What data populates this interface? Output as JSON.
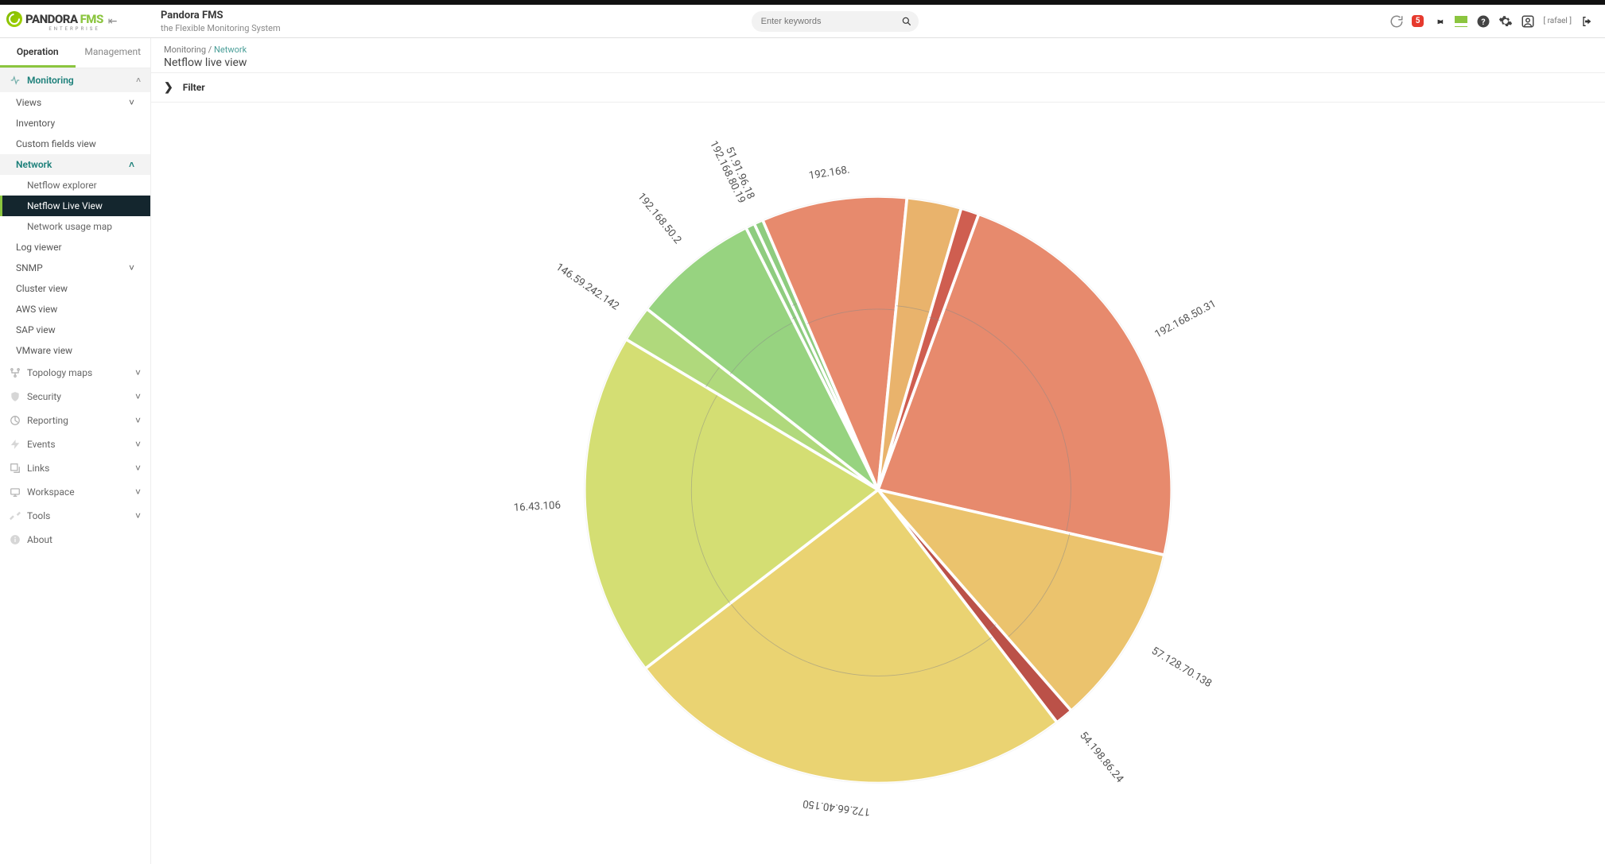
{
  "header": {
    "product": "PANDORA",
    "product_suffix": "FMS",
    "edition": "ENTERPRISE",
    "title": "Pandora FMS",
    "subtitle": "the Flexible Monitoring System",
    "search_placeholder": "Enter keywords",
    "alert_count": "5",
    "user_label": "[ rafael ]"
  },
  "tabs": {
    "operation": "Operation",
    "management": "Management"
  },
  "sidebar": {
    "monitoring": "Monitoring",
    "views": "Views",
    "inventory": "Inventory",
    "custom_fields": "Custom fields view",
    "network": "Network",
    "netflow_explorer": "Netflow explorer",
    "netflow_live": "Netflow Live View",
    "usage_map": "Network usage map",
    "log_viewer": "Log viewer",
    "snmp": "SNMP",
    "cluster": "Cluster view",
    "aws": "AWS view",
    "sap": "SAP view",
    "vmware": "VMware view",
    "topology": "Topology maps",
    "security": "Security",
    "reporting": "Reporting",
    "events": "Events",
    "links": "Links",
    "workspace": "Workspace",
    "tools": "Tools",
    "about": "About"
  },
  "breadcrumb": {
    "root": "Monitoring",
    "leaf": "Network",
    "page": "Netflow live view"
  },
  "filter": {
    "label": "Filter"
  },
  "chart_data": {
    "type": "pie",
    "title": "",
    "series": [
      {
        "name": "192.168.50.31",
        "value": 23,
        "color": "#e47a5a"
      },
      {
        "name": "57.128.70.138",
        "value": 10,
        "color": "#e9bb59"
      },
      {
        "name": "54.198.86.24",
        "value": 1,
        "color": "#b23a2f"
      },
      {
        "name": "172.66.40.150",
        "value": 25,
        "color": "#e8ce5f"
      },
      {
        "name": "16.43.106",
        "value": 19,
        "color": "#cfda60"
      },
      {
        "name": "146.59.242.142",
        "value": 2,
        "color": "#a6d46a"
      },
      {
        "name": "192.168.50.2",
        "value": 7,
        "color": "#89cd6f"
      },
      {
        "name": "192.168.80.19",
        "value": 0.5,
        "color": "#7fc66e"
      },
      {
        "name": "51.91.96.18",
        "value": 0.5,
        "color": "#7fc66e"
      },
      {
        "name": "192.168.",
        "value": 8,
        "color": "#e47a5a"
      },
      {
        "name": "",
        "value": 3,
        "color": "#e7a958"
      },
      {
        "name": "",
        "value": 1,
        "color": "#c94838"
      }
    ]
  }
}
